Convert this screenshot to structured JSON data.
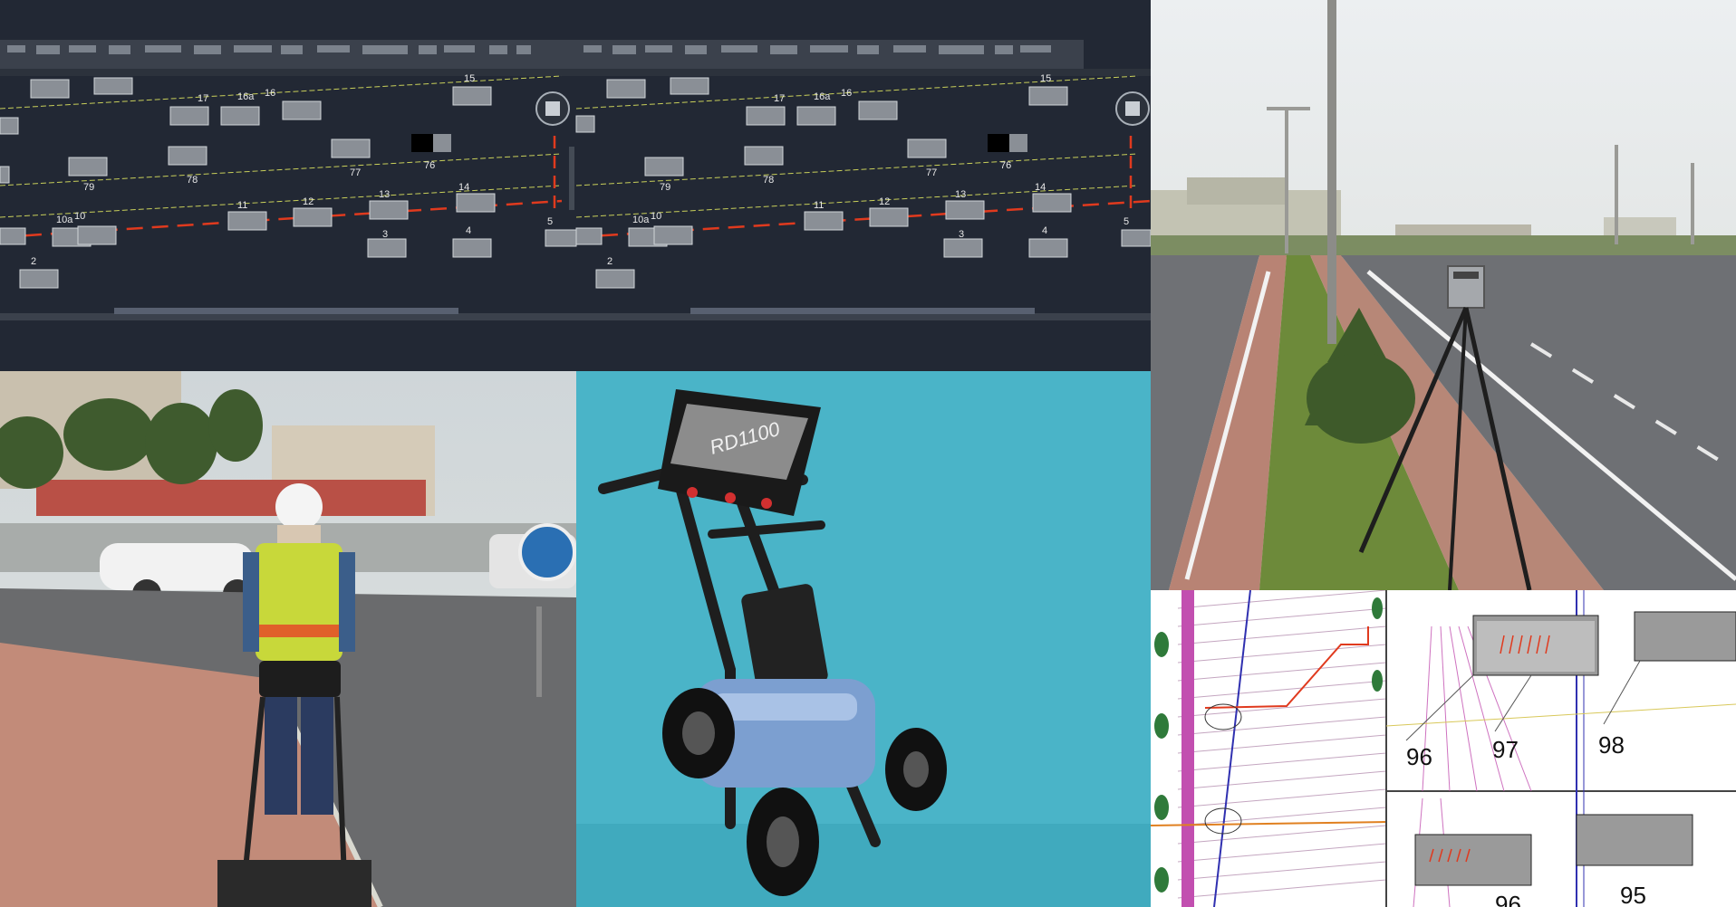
{
  "cad": {
    "labels_a": [
      "15",
      "17",
      "16a",
      "16",
      "76",
      "77",
      "78",
      "79",
      "10a",
      "10",
      "11",
      "12",
      "13",
      "14",
      "3",
      "4",
      "5",
      "2"
    ],
    "labels_b": [
      "15",
      "17",
      "16a",
      "16",
      "76",
      "77",
      "78",
      "79",
      "10a",
      "10",
      "11",
      "12",
      "13",
      "14",
      "3",
      "4",
      "5",
      "2"
    ]
  },
  "device": {
    "model": "RD1100"
  },
  "plan": {
    "labels": [
      "96",
      "97",
      "98",
      "95",
      "96"
    ]
  },
  "colors": {
    "cad_bg": "#222834",
    "cad_toolbar": "#3b414c",
    "cad_red_line": "#e03a1e",
    "cad_yellow_line": "#c8cf5a",
    "product_bg": "#4ab4c8",
    "plan_pink": "#c24fb0"
  }
}
